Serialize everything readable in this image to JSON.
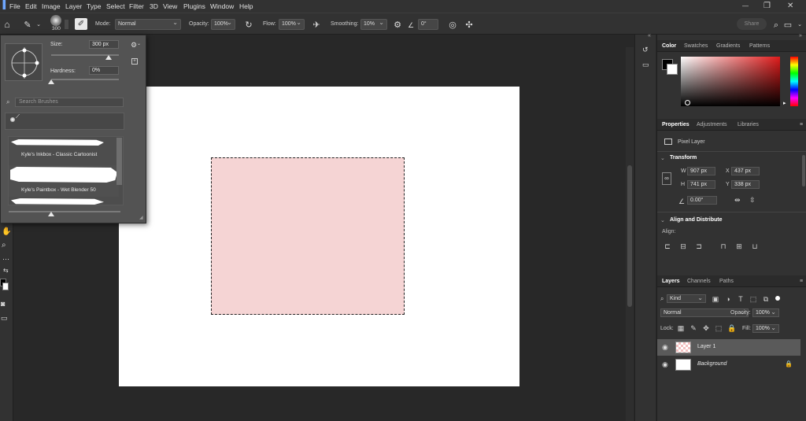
{
  "menu": {
    "items": [
      "File",
      "Edit",
      "Image",
      "Layer",
      "Type",
      "Select",
      "Filter",
      "3D",
      "View",
      "Plugins",
      "Window",
      "Help"
    ],
    "share_label": "Share"
  },
  "options_bar": {
    "brush_size_value": "300",
    "mode_label": "Mode:",
    "mode_value": "Normal",
    "opacity_label": "Opacity:",
    "opacity_value": "100%",
    "flow_label": "Flow:",
    "flow_value": "100%",
    "smoothing_label": "Smoothing:",
    "smoothing_value": "10%",
    "angle_value": "0°"
  },
  "brush_picker": {
    "size_label": "Size:",
    "size_value": "300 px",
    "size_fraction": 0.85,
    "hardness_label": "Hardness:",
    "hardness_value": "0%",
    "search_placeholder": "Search Brushes",
    "brushes": [
      {
        "name": "Kyle's Inkbox - Classic Cartoonist"
      },
      {
        "name": "Kyle's Paintbox - Wet Blender 50"
      }
    ]
  },
  "color_panel": {
    "tabs": [
      "Color",
      "Swatches",
      "Gradients",
      "Patterns"
    ],
    "foreground_color": "#000000",
    "background_color": "#ffffff",
    "hue_color": "#e01b1b"
  },
  "properties_panel": {
    "tabs": [
      "Properties",
      "Adjustments",
      "Libraries"
    ],
    "layer_type": "Pixel Layer",
    "transform_title": "Transform",
    "w_label": "W",
    "w_value": "907 px",
    "h_label": "H",
    "h_value": "741 px",
    "x_label": "X",
    "x_value": "437 px",
    "y_label": "Y",
    "y_value": "338 px",
    "angle_value": "0.00°",
    "align_title": "Align and Distribute",
    "align_label": "Align:"
  },
  "layers_panel": {
    "tabs": [
      "Layers",
      "Channels",
      "Paths"
    ],
    "filter_value": "Kind",
    "blend_mode": "Normal",
    "opacity_label": "Opacity:",
    "opacity_value": "100%",
    "lock_label": "Lock:",
    "fill_label": "Fill:",
    "fill_value": "100%",
    "layers": [
      {
        "name": "Layer 1",
        "selected": true
      },
      {
        "name": "Background",
        "selected": false
      }
    ]
  },
  "document": {
    "selection_fill": "#f5d4d4"
  }
}
